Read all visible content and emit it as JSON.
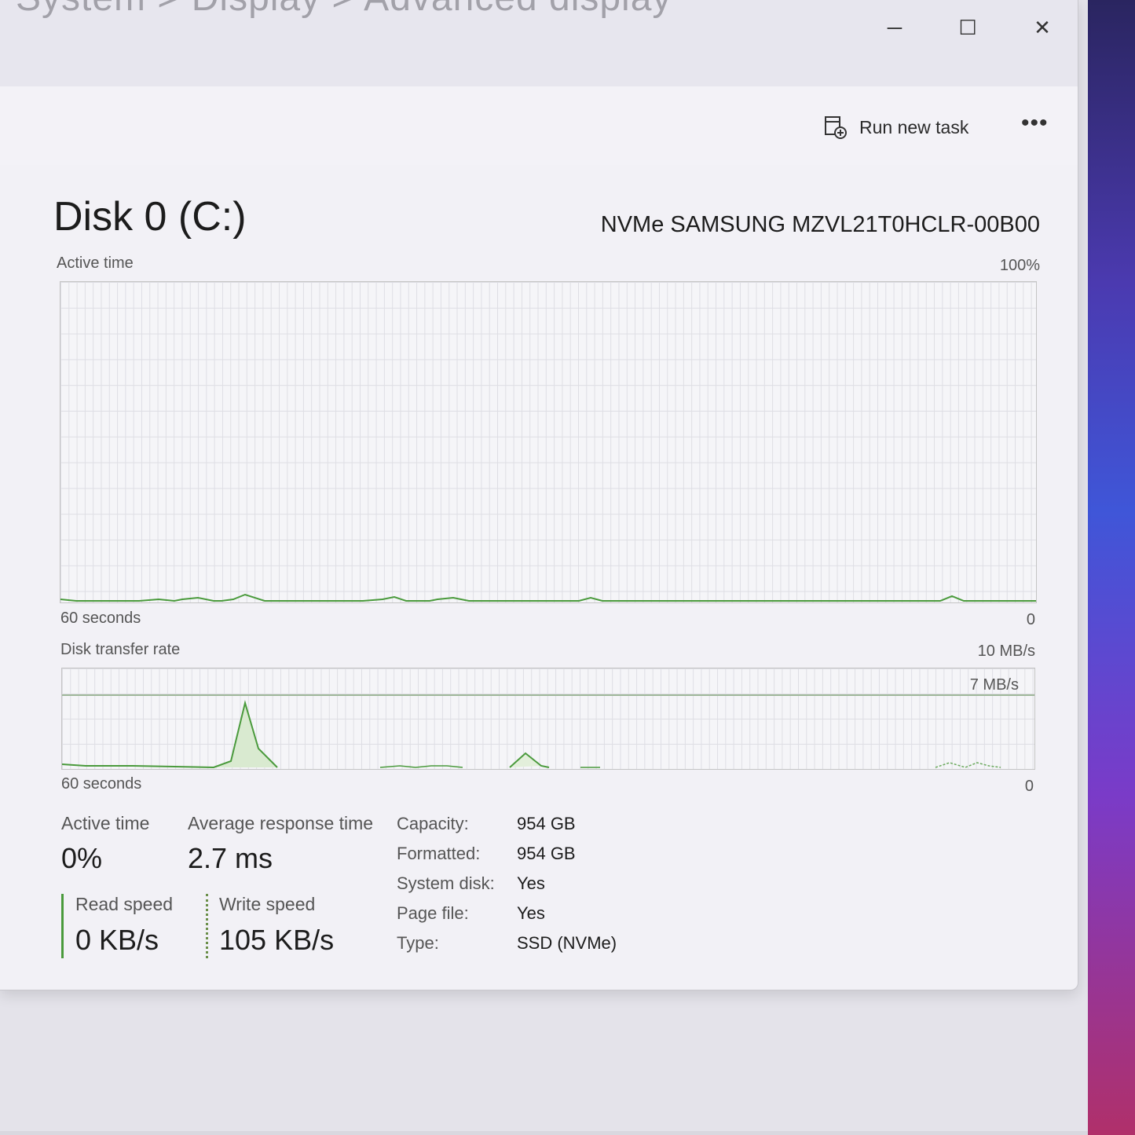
{
  "title_bar": {
    "faded_title": "System  >  Display  >  Advanced display",
    "minimize_glyph": "─",
    "maximize_glyph": "☐",
    "close_glyph": "✕"
  },
  "toolbar": {
    "run_new_task_label": "Run new task",
    "more_glyph": "•••"
  },
  "disk": {
    "title": "Disk 0 (C:)",
    "model": "NVMe SAMSUNG MZVL21T0HCLR-00B00"
  },
  "active_time_graph": {
    "label": "Active time",
    "max_label": "100%",
    "time_label": "60 seconds",
    "min_label": "0"
  },
  "transfer_graph": {
    "label": "Disk transfer rate",
    "max_label": "10 MB/s",
    "ref_label": "7 MB/s",
    "time_label": "60 seconds",
    "min_label": "0"
  },
  "stats": {
    "active_time_label": "Active time",
    "active_time_value": "0%",
    "avg_response_label": "Average response time",
    "avg_response_value": "2.7 ms",
    "read_speed_label": "Read speed",
    "read_speed_value": "0 KB/s",
    "write_speed_label": "Write speed",
    "write_speed_value": "105 KB/s"
  },
  "properties": [
    {
      "key": "Capacity:",
      "value": "954 GB"
    },
    {
      "key": "Formatted:",
      "value": "954 GB"
    },
    {
      "key": "System disk:",
      "value": "Yes"
    },
    {
      "key": "Page file:",
      "value": "Yes"
    },
    {
      "key": "Type:",
      "value": "SSD (NVMe)"
    }
  ],
  "colors": {
    "graph_line": "#4a9a3c",
    "graph_fill": "#d9ead0"
  }
}
